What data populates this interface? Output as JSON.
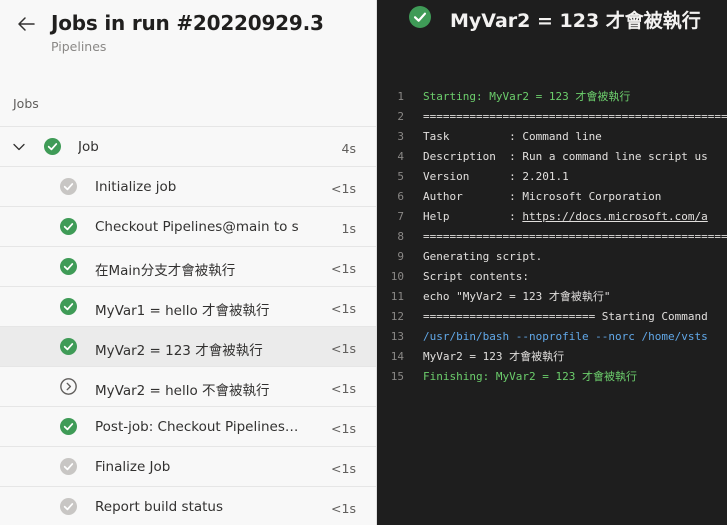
{
  "header": {
    "title": "Jobs in run #20220929.3",
    "subtitle": "Pipelines"
  },
  "section_label": "Jobs",
  "job": {
    "label": "Job",
    "duration": "4s",
    "status": "success"
  },
  "steps": [
    {
      "label": "Initialize job",
      "duration": "<1s",
      "status": "success-muted"
    },
    {
      "label": "Checkout Pipelines@main to s",
      "duration": "1s",
      "status": "success"
    },
    {
      "label": "在Main分支才會被執行",
      "duration": "<1s",
      "status": "success"
    },
    {
      "label": "MyVar1 = hello 才會被執行",
      "duration": "<1s",
      "status": "success"
    },
    {
      "label": "MyVar2 = 123 才會被執行",
      "duration": "<1s",
      "status": "success",
      "selected": true
    },
    {
      "label": "MyVar2 = hello 不會被執行",
      "duration": "<1s",
      "status": "skipped"
    },
    {
      "label": "Post-job: Checkout Pipelines@m...",
      "duration": "<1s",
      "status": "success"
    },
    {
      "label": "Finalize Job",
      "duration": "<1s",
      "status": "success-muted"
    },
    {
      "label": "Report build status",
      "duration": "<1s",
      "status": "success-muted"
    }
  ],
  "log": {
    "title": "MyVar2 = 123 才會被執行",
    "lines": [
      {
        "n": "1",
        "text": "Starting: MyVar2 = 123 才會被執行",
        "style": "green"
      },
      {
        "n": "2",
        "text": "==============================================================================",
        "style": ""
      },
      {
        "n": "3",
        "text": "Task         : Command line",
        "style": ""
      },
      {
        "n": "4",
        "text": "Description  : Run a command line script us",
        "style": ""
      },
      {
        "n": "5",
        "text": "Version      : 2.201.1",
        "style": ""
      },
      {
        "n": "6",
        "text": "Author       : Microsoft Corporation",
        "style": ""
      },
      {
        "n": "7",
        "text": "Help         : ",
        "link": "https://docs.microsoft.com/a",
        "style": ""
      },
      {
        "n": "8",
        "text": "==============================================================================",
        "style": ""
      },
      {
        "n": "9",
        "text": "Generating script.",
        "style": ""
      },
      {
        "n": "10",
        "text": "Script contents:",
        "style": ""
      },
      {
        "n": "11",
        "text": "echo \"MyVar2 = 123 才會被執行\"",
        "style": ""
      },
      {
        "n": "12",
        "text": "========================== Starting Command",
        "style": ""
      },
      {
        "n": "13",
        "text": "/usr/bin/bash --noprofile --norc /home/vsts",
        "style": "blue"
      },
      {
        "n": "14",
        "text": "MyVar2 = 123 才會被執行",
        "style": ""
      },
      {
        "n": "15",
        "text": "Finishing: MyVar2 = 123 才會被執行",
        "style": "green"
      }
    ]
  },
  "colors": {
    "success": "#3f9b57",
    "success_muted": "#c8c6c4",
    "skipped": "#605e5c",
    "log_green": "#6cce6c",
    "log_blue": "#61a8e8"
  }
}
